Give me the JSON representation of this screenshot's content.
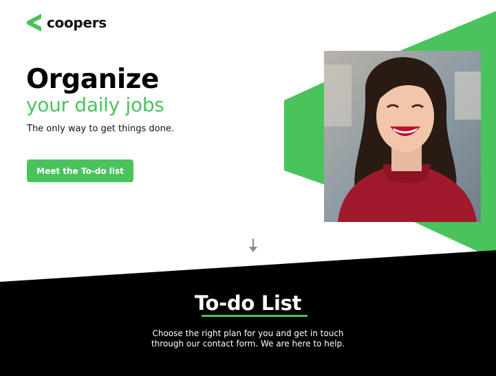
{
  "brand": {
    "name": "coopers",
    "accent_color": "#4ac35d"
  },
  "hero": {
    "title": "Organize",
    "subtitle": "your daily jobs",
    "tagline": "The only way to get things done.",
    "cta_label": "Meet the To-do list"
  },
  "hero_image": {
    "alt": "smiling woman in red sweater"
  },
  "scroll_icon": "arrow-down-icon",
  "section": {
    "title": "To-do List",
    "description_line1": "Choose the right plan for you and get in touch",
    "description_line2": "through our contact form. We are here to help.",
    "background_color": "#000000"
  }
}
